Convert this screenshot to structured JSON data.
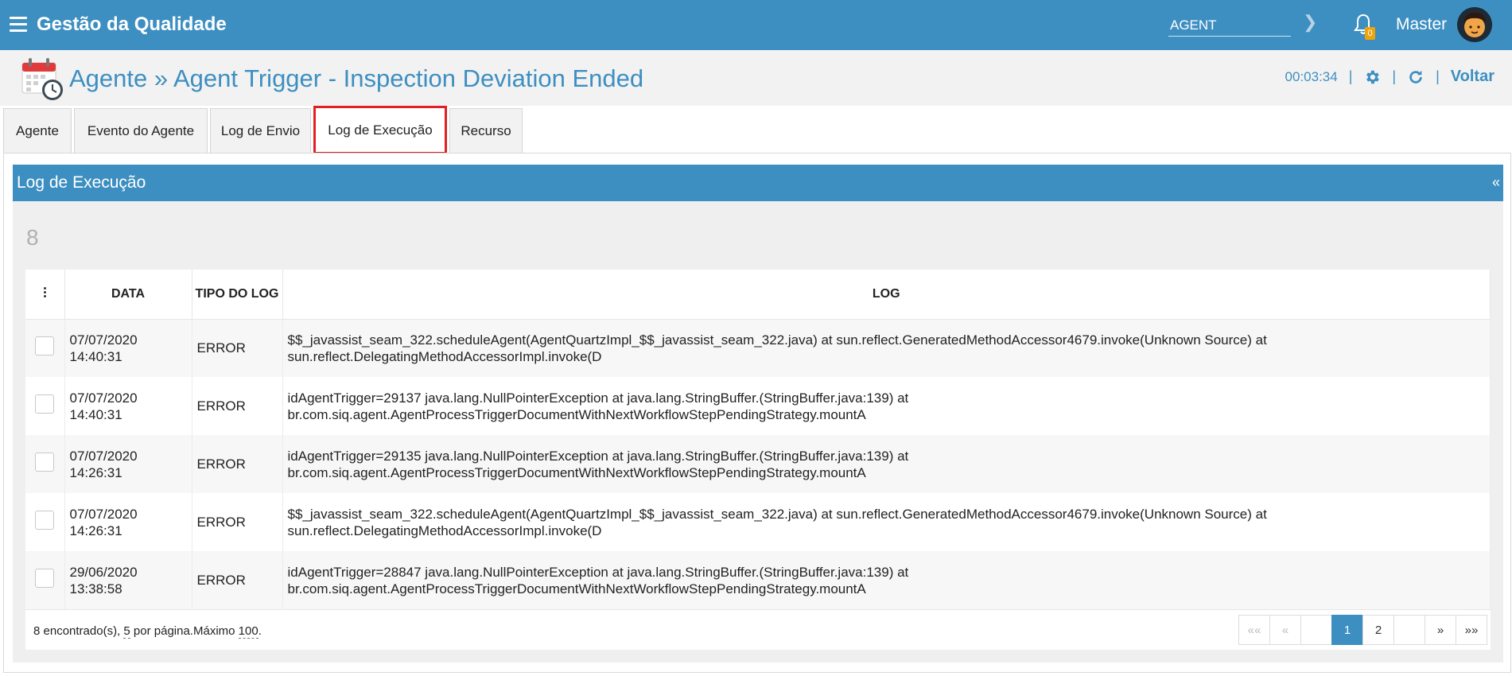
{
  "app": {
    "title": "Gestão da Qualidade"
  },
  "search": {
    "value": "AGENT"
  },
  "notifications": {
    "count": "0"
  },
  "user": {
    "name": "Master"
  },
  "header": {
    "title": "Agente » Agent Trigger - Inspection Deviation Ended",
    "timer": "00:03:34",
    "back_label": "Voltar"
  },
  "tabs": [
    {
      "label": "Agente"
    },
    {
      "label": "Evento do Agente"
    },
    {
      "label": "Log de Envio"
    },
    {
      "label": "Log de Execução",
      "active": true
    },
    {
      "label": "Recurso"
    }
  ],
  "panel": {
    "title": "Log de Execução",
    "collapse_icon": "«",
    "record_count": "8"
  },
  "table": {
    "columns": {
      "data": "DATA",
      "tipo": "TIPO DO LOG",
      "log": "LOG"
    },
    "rows": [
      {
        "data_date": "07/07/2020",
        "data_time": "14:40:31",
        "tipo": "ERROR",
        "log": "$$_javassist_seam_322.scheduleAgent(AgentQuartzImpl_$$_javassist_seam_322.java) at sun.reflect.GeneratedMethodAccessor4679.invoke(Unknown Source) at sun.reflect.DelegatingMethodAccessorImpl.invoke(D"
      },
      {
        "data_date": "07/07/2020",
        "data_time": "14:40:31",
        "tipo": "ERROR",
        "log": "idAgentTrigger=29137 java.lang.NullPointerException at java.lang.StringBuffer.(StringBuffer.java:139) at br.com.siq.agent.AgentProcessTriggerDocumentWithNextWorkflowStepPendingStrategy.mountA"
      },
      {
        "data_date": "07/07/2020",
        "data_time": "14:26:31",
        "tipo": "ERROR",
        "log": "idAgentTrigger=29135 java.lang.NullPointerException at java.lang.StringBuffer.(StringBuffer.java:139) at br.com.siq.agent.AgentProcessTriggerDocumentWithNextWorkflowStepPendingStrategy.mountA"
      },
      {
        "data_date": "07/07/2020",
        "data_time": "14:26:31",
        "tipo": "ERROR",
        "log": "$$_javassist_seam_322.scheduleAgent(AgentQuartzImpl_$$_javassist_seam_322.java) at sun.reflect.GeneratedMethodAccessor4679.invoke(Unknown Source) at sun.reflect.DelegatingMethodAccessorImpl.invoke(D"
      },
      {
        "data_date": "29/06/2020",
        "data_time": "13:38:58",
        "tipo": "ERROR",
        "log": "idAgentTrigger=28847 java.lang.NullPointerException at java.lang.StringBuffer.(StringBuffer.java:139) at br.com.siq.agent.AgentProcessTriggerDocumentWithNextWorkflowStepPendingStrategy.mountA"
      }
    ]
  },
  "footer": {
    "found_prefix": "8 encontrado(s), ",
    "per_page": "5",
    "per_page_suffix": " por página.Máximo ",
    "max": "100",
    "end": "."
  },
  "pagination": {
    "first": "««",
    "prev": "«",
    "pages": [
      "1",
      "2"
    ],
    "current": "1",
    "next": "»",
    "last": "»»"
  },
  "colors": {
    "primary": "#3d8fc1",
    "active_tab_border": "#e02027",
    "badge": "#f0a30a"
  }
}
